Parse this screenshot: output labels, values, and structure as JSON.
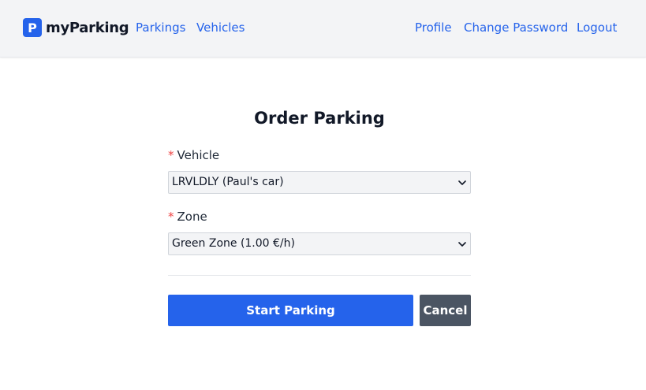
{
  "brand": {
    "logo_letter": "P",
    "name": "myParking"
  },
  "nav": {
    "left": [
      {
        "label": "Parkings"
      },
      {
        "label": "Vehicles"
      }
    ],
    "right": [
      {
        "label": "Profile"
      },
      {
        "label": "Change Password"
      },
      {
        "label": "Logout"
      }
    ]
  },
  "form": {
    "title": "Order Parking",
    "required_marker": "*",
    "vehicle": {
      "label": "Vehicle",
      "value": "LRVLDLY (Paul's car)"
    },
    "zone": {
      "label": "Zone",
      "value": "Green Zone (1.00 €/h)"
    },
    "start_label": "Start Parking",
    "cancel_label": "Cancel"
  },
  "colors": {
    "accent": "#2563eb",
    "required": "#ef4444",
    "cancel_bg": "#4b5563",
    "navbar_bg": "#f3f4f6"
  },
  "icons": {
    "select_arrow": "chevron-down-icon"
  }
}
